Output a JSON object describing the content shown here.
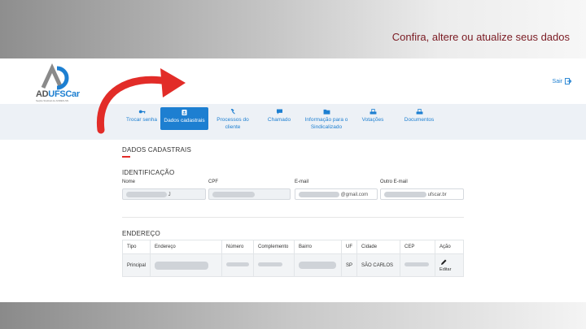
{
  "banner": {
    "caption": "Confira, altere ou atualize seus dados"
  },
  "brand": {
    "name_part1": "AD",
    "name_part2": "UFSCar",
    "subtitle": "Seção Sindical do ANDES-SN"
  },
  "header": {
    "logout_label": "Sair"
  },
  "nav": {
    "items": [
      {
        "label": "Trocar senha",
        "icon": "key-icon"
      },
      {
        "label": "Dados cadastrais",
        "icon": "id-card-icon",
        "active": true
      },
      {
        "label": "Processos do cliente",
        "icon": "gavel-icon"
      },
      {
        "label": "Chamado",
        "icon": "chat-icon"
      },
      {
        "label": "Informação para o Sindicalizado",
        "icon": "folder-icon"
      },
      {
        "label": "Votações",
        "icon": "ballot-icon"
      },
      {
        "label": "Documentos",
        "icon": "document-icon"
      }
    ]
  },
  "page": {
    "title": "DADOS CADASTRAIS",
    "identificacao": {
      "title": "IDENTIFICAÇÃO",
      "fields": {
        "nome_label": "Nome",
        "nome_value": "J",
        "cpf_label": "CPF",
        "email_label": "E-mail",
        "email_value": "@gmail.com",
        "outro_email_label": "Outro E-mail",
        "outro_email_value": "ufscar.br"
      }
    },
    "endereco": {
      "title": "ENDEREÇO",
      "columns": [
        "Tipo",
        "Endereço",
        "Número",
        "Complemento",
        "Bairro",
        "UF",
        "Cidade",
        "CEP",
        "Ação"
      ],
      "row": {
        "tipo": "Principal",
        "uf": "SP",
        "cidade": "SÃO CARLOS",
        "acao": "Editar"
      }
    }
  },
  "colors": {
    "accent": "#1d7fd1",
    "highlight": "#e22c28",
    "caption": "#7a1a22"
  }
}
